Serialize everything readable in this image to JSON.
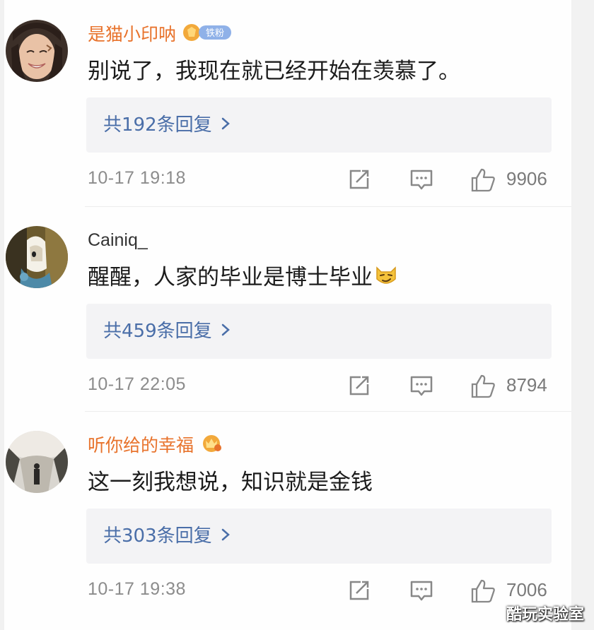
{
  "comments": [
    {
      "username": "是猫小印呐",
      "username_style": "vip",
      "badge_text": "铁粉",
      "text": "别说了，我现在就已经开始在羡慕了。",
      "replies_label": "共192条回复",
      "time": "10-17 19:18",
      "likes": "9906"
    },
    {
      "username": "Cainiq_",
      "username_style": "plain",
      "text": "醒醒，人家的毕业是博士毕业",
      "replies_label": "共459条回复",
      "time": "10-17 22:05",
      "likes": "8794"
    },
    {
      "username": "听你给的幸福",
      "username_style": "vip",
      "text": "这一刻我想说，知识就是金钱",
      "replies_label": "共303条回复",
      "time": "10-17 19:38",
      "likes": "7006"
    }
  ],
  "icons": {
    "repost": "repost-icon",
    "comment": "comment-icon",
    "like": "thumbs-up-icon",
    "chevron": "chevron-right-icon"
  },
  "colors": {
    "vip_name": "#e8732c",
    "reply_link": "#4a6ea8",
    "meta_gray": "#8c8c8c"
  },
  "watermark": "酷玩实验室"
}
